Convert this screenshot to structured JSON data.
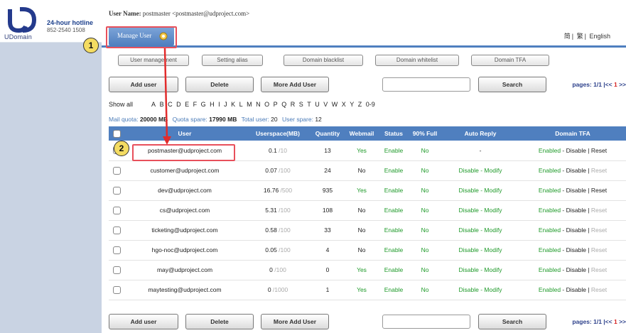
{
  "brand": {
    "logo_text": "UDomain",
    "hotline_title": "24-hour hotline",
    "hotline_number": "852-2540 1508"
  },
  "header": {
    "user_label": "User Name:",
    "user_value": "postmaster <postmaster@udproject.com>",
    "languages": [
      "简",
      "繁",
      "English"
    ],
    "tab": "Manage User"
  },
  "subtabs": [
    "User management",
    "Setting alias",
    "Domain blacklist",
    "Domain whitelist",
    "Domain TFA"
  ],
  "actions": {
    "add_user": "Add user",
    "delete": "Delete",
    "more_add_user": "More Add User",
    "search": "Search",
    "pages": "pages: 1/1 |<< ",
    "page_current": "1",
    "pages_next": " >>"
  },
  "filter": {
    "show_all": "Show all",
    "letters": [
      "A",
      "B",
      "C",
      "D",
      "E",
      "F",
      "G",
      "H",
      "I",
      "J",
      "K",
      "L",
      "M",
      "N",
      "O",
      "P",
      "Q",
      "R",
      "S",
      "T",
      "U",
      "V",
      "W",
      "X",
      "Y",
      "Z",
      "0-9"
    ]
  },
  "quota": {
    "mail_quota_label": "Mail quota:",
    "mail_quota_value": "20000",
    "mail_quota_unit": "MB",
    "quota_spare_label": "Quota spare:",
    "quota_spare_value": "17990",
    "quota_spare_unit": "MB",
    "total_user_label": "Total user:",
    "total_user_value": "20",
    "user_spare_label": "User spare:",
    "user_spare_value": "12"
  },
  "table": {
    "headers": [
      "",
      "User",
      "Userspace(MB)",
      "Quantity",
      "Webmail",
      "Status",
      "90% Full",
      "Auto Reply",
      "Domain TFA"
    ],
    "rows": [
      {
        "user": "postmaster@udproject.com",
        "used": "0.1",
        "limit": " /10",
        "quantity": "13",
        "webmail": "Yes",
        "status": "Enable",
        "full": "No",
        "reply": "-",
        "tfa_enabled": "Enabled",
        "tfa_disable": " - Disable | ",
        "tfa_reset": "Reset",
        "reset_active": true
      },
      {
        "user": "customer@udproject.com",
        "used": "0.07",
        "limit": " /100",
        "quantity": "24",
        "webmail": "No",
        "status": "Enable",
        "full": "No",
        "reply": "Disable - Modify",
        "tfa_enabled": "Enabled",
        "tfa_disable": " - Disable | ",
        "tfa_reset": "Reset",
        "reset_active": false
      },
      {
        "user": "dev@udproject.com",
        "used": "16.76",
        "limit": " /500",
        "quantity": "935",
        "webmail": "Yes",
        "status": "Enable",
        "full": "No",
        "reply": "Disable - Modify",
        "tfa_enabled": "Enabled",
        "tfa_disable": " - Disable | ",
        "tfa_reset": "Reset",
        "reset_active": true
      },
      {
        "user": "cs@udproject.com",
        "used": "5.31",
        "limit": " /100",
        "quantity": "108",
        "webmail": "No",
        "status": "Enable",
        "full": "No",
        "reply": "Disable - Modify",
        "tfa_enabled": "Enabled",
        "tfa_disable": " - Disable | ",
        "tfa_reset": "Reset",
        "reset_active": false
      },
      {
        "user": "ticketing@udproject.com",
        "used": "0.58",
        "limit": " /100",
        "quantity": "33",
        "webmail": "No",
        "status": "Enable",
        "full": "No",
        "reply": "Disable - Modify",
        "tfa_enabled": "Enabled",
        "tfa_disable": " - Disable | ",
        "tfa_reset": "Reset",
        "reset_active": false
      },
      {
        "user": "hgo-noc@udproject.com",
        "used": "0.05",
        "limit": " /100",
        "quantity": "4",
        "webmail": "No",
        "status": "Enable",
        "full": "No",
        "reply": "Disable - Modify",
        "tfa_enabled": "Enabled",
        "tfa_disable": " - Disable | ",
        "tfa_reset": "Reset",
        "reset_active": false
      },
      {
        "user": "may@udproject.com",
        "used": "0",
        "limit": " /100",
        "quantity": "0",
        "webmail": "Yes",
        "status": "Enable",
        "full": "No",
        "reply": "Disable - Modify",
        "tfa_enabled": "Enabled",
        "tfa_disable": " - Disable | ",
        "tfa_reset": "Reset",
        "reset_active": false
      },
      {
        "user": "maytesting@udproject.com",
        "used": "0",
        "limit": " /1000",
        "quantity": "1",
        "webmail": "Yes",
        "status": "Enable",
        "full": "No",
        "reply": "Disable - Modify",
        "tfa_enabled": "Enabled",
        "tfa_disable": " - Disable | ",
        "tfa_reset": "Reset",
        "reset_active": false
      }
    ]
  },
  "annotations": {
    "step1": "1",
    "step2": "2"
  },
  "colors": {
    "accent": "#4f7fbf",
    "annotation": "#e8505b",
    "enabled_green": "#1f9a2a"
  }
}
